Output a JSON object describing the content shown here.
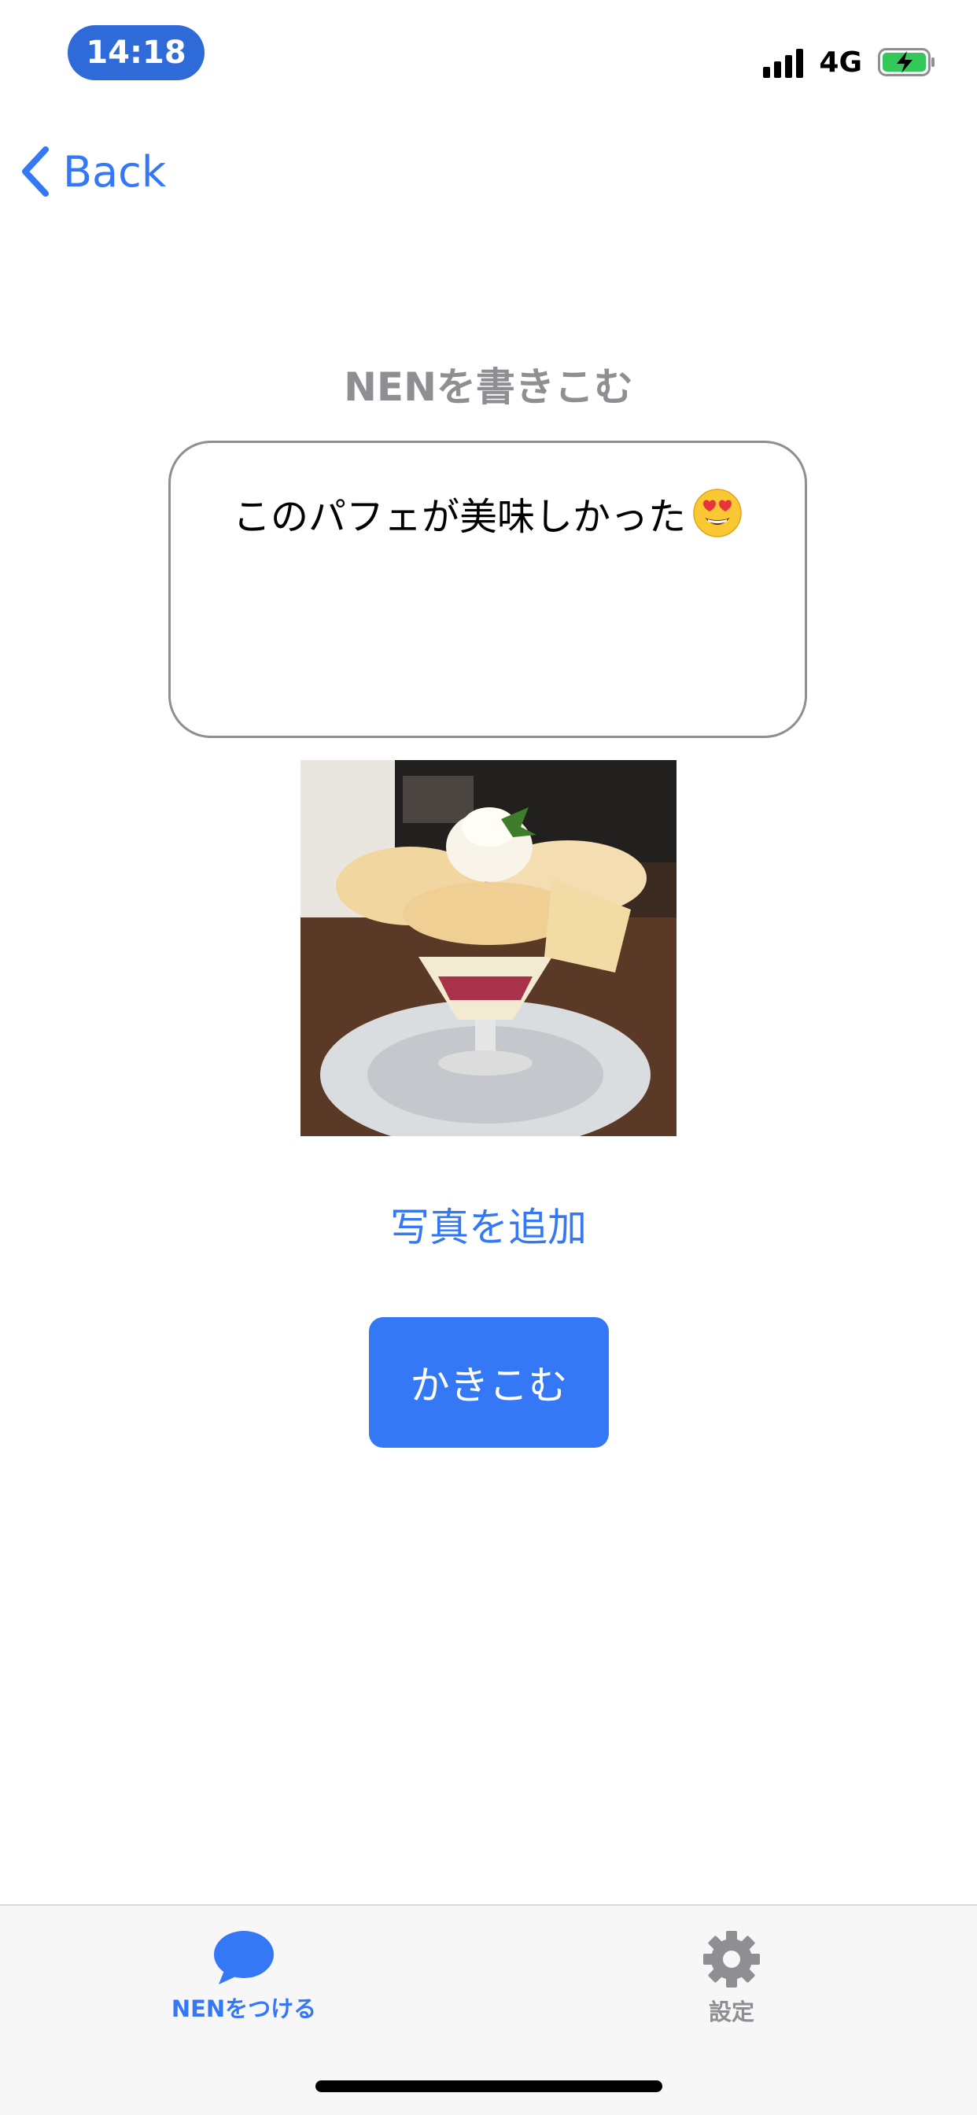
{
  "status_bar": {
    "time": "14:18",
    "network": "4G"
  },
  "nav": {
    "back_label": "Back"
  },
  "compose": {
    "title": "NENを書きこむ",
    "text": "このパフェが美味しかった",
    "emoji": "smiling-face-with-heart-eyes"
  },
  "actions": {
    "add_photo_label": "写真を追加",
    "submit_label": "かきこむ"
  },
  "tabbar": {
    "items": [
      {
        "label": "NENをつける",
        "icon": "speech-bubble-icon",
        "active": true
      },
      {
        "label": "設定",
        "icon": "gear-icon",
        "active": false
      }
    ]
  },
  "colors": {
    "accent": "#3478f6",
    "time_pill": "#2f6ad9",
    "muted": "#8e8e93"
  }
}
